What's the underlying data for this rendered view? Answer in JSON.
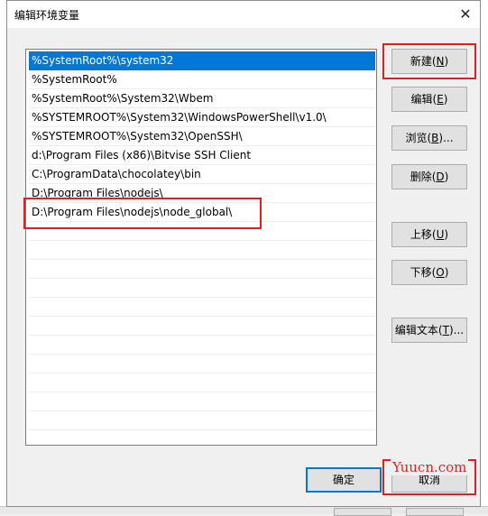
{
  "dialog": {
    "title": "编辑环境变量",
    "close_glyph": "✕"
  },
  "list": {
    "selected_index": 0,
    "items": [
      "%SystemRoot%\\system32",
      "%SystemRoot%",
      "%SystemRoot%\\System32\\Wbem",
      "%SYSTEMROOT%\\System32\\WindowsPowerShell\\v1.0\\",
      "%SYSTEMROOT%\\System32\\OpenSSH\\",
      "d:\\Program Files (x86)\\Bitvise SSH Client",
      "C:\\ProgramData\\chocolatey\\bin",
      "D:\\Program Files\\nodejs\\",
      "D:\\Program Files\\nodejs\\node_global\\"
    ]
  },
  "buttons": {
    "new": {
      "label": "新建(",
      "key": "N",
      "end": ")"
    },
    "edit": {
      "label": "编辑(",
      "key": "E",
      "end": ")"
    },
    "browse": {
      "label": "浏览(",
      "key": "B",
      "end": ")..."
    },
    "delete": {
      "label": "删除(",
      "key": "D",
      "end": ")"
    },
    "move_up": {
      "label": "上移(",
      "key": "U",
      "end": ")"
    },
    "move_down": {
      "label": "下移(",
      "key": "O",
      "end": ")"
    },
    "edit_text": {
      "label": "编辑文本(",
      "key": "T",
      "end": ")..."
    },
    "ok": {
      "label": "确定"
    },
    "cancel": {
      "label": "取消"
    }
  },
  "watermark": "Yuucn.com",
  "colors": {
    "selection": "#0078d7",
    "highlight_box": "#e02020"
  }
}
